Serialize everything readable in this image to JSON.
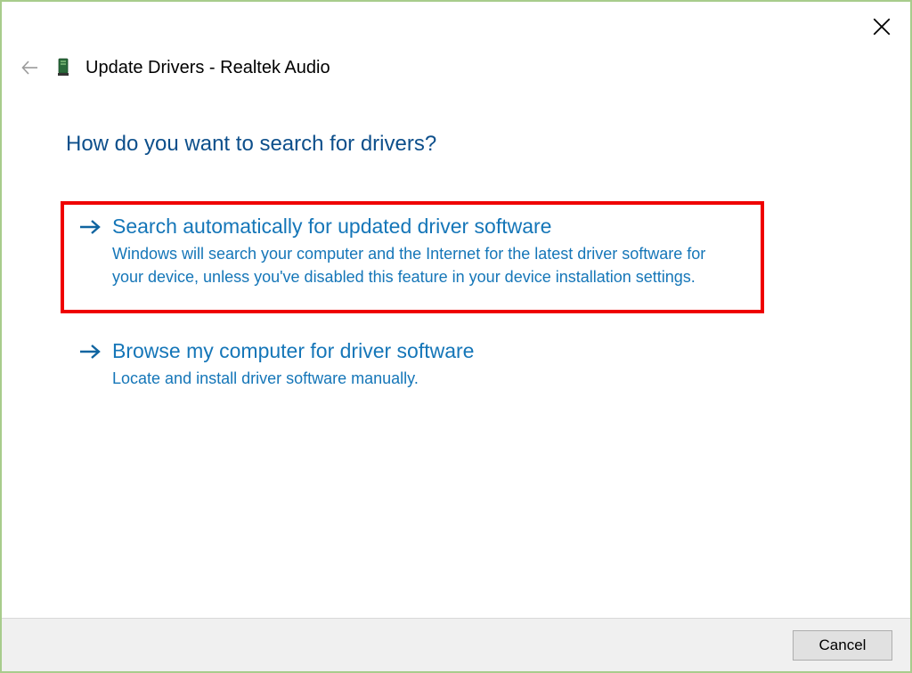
{
  "window": {
    "title": "Update Drivers - Realtek Audio"
  },
  "main": {
    "heading": "How do you want to search for drivers?"
  },
  "options": {
    "auto": {
      "title": "Search automatically for updated driver software",
      "description": "Windows will search your computer and the Internet for the latest driver software for your device, unless you've disabled this feature in your device installation settings."
    },
    "browse": {
      "title": "Browse my computer for driver software",
      "description": "Locate and install driver software manually."
    }
  },
  "footer": {
    "cancel_label": "Cancel"
  }
}
